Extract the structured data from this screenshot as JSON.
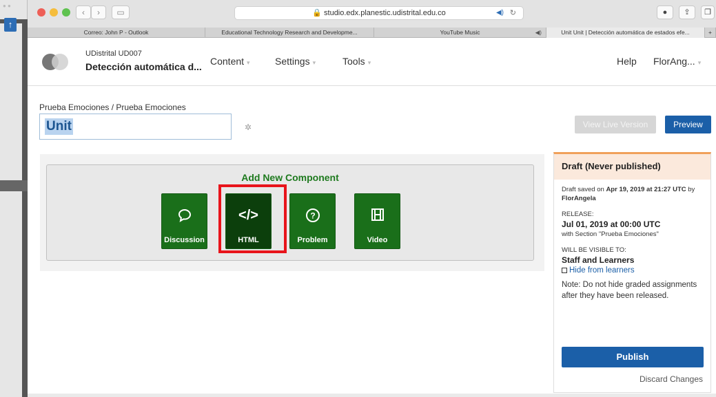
{
  "browser": {
    "url": "studio.edx.planestic.udistrital.edu.co",
    "tabs": [
      {
        "title": "Correo: John P - Outlook",
        "active": false,
        "sound": false
      },
      {
        "title": "Educational Technology Research and Developme...",
        "active": false,
        "sound": false
      },
      {
        "title": "YouTube Music",
        "active": false,
        "sound": true
      },
      {
        "title": "Unit Unit | Detección automática de estados efe...",
        "active": true,
        "sound": false
      }
    ]
  },
  "header": {
    "course_org": "UDistrital UD007",
    "course_name": "Detección automática d...",
    "menu": [
      "Content",
      "Settings",
      "Tools"
    ],
    "help": "Help",
    "user": "FlorAng..."
  },
  "page": {
    "breadcrumb": "Prueba Emociones / Prueba Emociones",
    "unit_title": "Unit",
    "view_live": "View Live Version",
    "preview": "Preview"
  },
  "components": {
    "title": "Add New Component",
    "buttons": [
      {
        "label": "Discussion",
        "icon": "speech-bubble-icon",
        "glyph": "💬"
      },
      {
        "label": "HTML",
        "icon": "html-code-icon",
        "glyph": "</>"
      },
      {
        "label": "Problem",
        "icon": "question-circle-icon",
        "glyph": "?"
      },
      {
        "label": "Video",
        "icon": "film-icon",
        "glyph": "🎞"
      }
    ]
  },
  "sidebar": {
    "status": "Draft (Never published)",
    "saved_prefix": "Draft saved on",
    "saved_date": "Apr 19, 2019 at 21:27 UTC",
    "saved_by": "by",
    "saved_user": "FlorAngela",
    "release_label": "RELEASE:",
    "release_date": "Jul 01, 2019 at 00:00 UTC",
    "release_section": "with Section \"Prueba Emociones\"",
    "visible_label": "WILL BE VISIBLE TO:",
    "visible_value": "Staff and Learners",
    "hide_link": "Hide from learners",
    "note": "Note: Do not hide graded assignments after they have been released.",
    "publish": "Publish",
    "discard": "Discard Changes"
  },
  "colors": {
    "green": "#1a6f1a",
    "blue": "#1b5fa8",
    "highlight": "#e8141b",
    "draft_border": "#f0a05a"
  }
}
